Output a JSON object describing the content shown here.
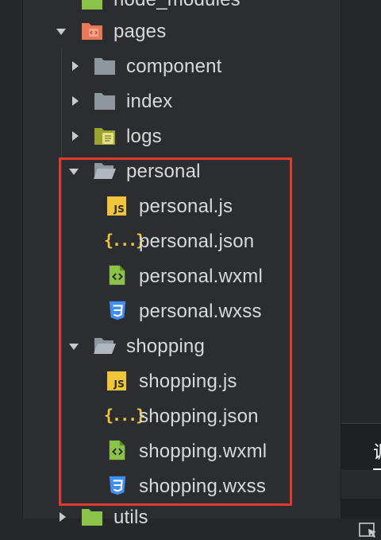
{
  "tree": {
    "items": [
      {
        "label": "node_modules",
        "depth": 1,
        "kind": "folder-package",
        "expanded": false
      },
      {
        "label": "pages",
        "depth": 1,
        "kind": "folder-pages",
        "expanded": true
      },
      {
        "label": "component",
        "depth": 2,
        "kind": "folder",
        "expanded": false
      },
      {
        "label": "index",
        "depth": 2,
        "kind": "folder",
        "expanded": false
      },
      {
        "label": "logs",
        "depth": 2,
        "kind": "folder-logs",
        "expanded": false
      },
      {
        "label": "personal",
        "depth": 2,
        "kind": "folder-open",
        "expanded": true
      },
      {
        "label": "personal.js",
        "depth": 3,
        "kind": "js-file"
      },
      {
        "label": "personal.json",
        "depth": 3,
        "kind": "json-file"
      },
      {
        "label": "personal.wxml",
        "depth": 3,
        "kind": "wxml-file"
      },
      {
        "label": "personal.wxss",
        "depth": 3,
        "kind": "wxss-file"
      },
      {
        "label": "shopping",
        "depth": 2,
        "kind": "folder-open",
        "expanded": true
      },
      {
        "label": "shopping.js",
        "depth": 3,
        "kind": "js-file"
      },
      {
        "label": "shopping.json",
        "depth": 3,
        "kind": "json-file"
      },
      {
        "label": "shopping.wxml",
        "depth": 3,
        "kind": "wxml-file"
      },
      {
        "label": "shopping.wxss",
        "depth": 3,
        "kind": "wxss-file"
      },
      {
        "label": "utils",
        "depth": 1,
        "kind": "folder-package",
        "expanded": false
      }
    ]
  },
  "icons": {
    "js_text": "JS",
    "json_text": "{...}"
  },
  "bottom_panel": {
    "tab_label": "调"
  },
  "colors": {
    "highlight_box": "#e0392f",
    "js": "#f0c43b",
    "wxml": "#8bc34a",
    "wxss": "#3f8ef0",
    "folder": "#8e969e",
    "pages_folder": "#e8785a"
  }
}
